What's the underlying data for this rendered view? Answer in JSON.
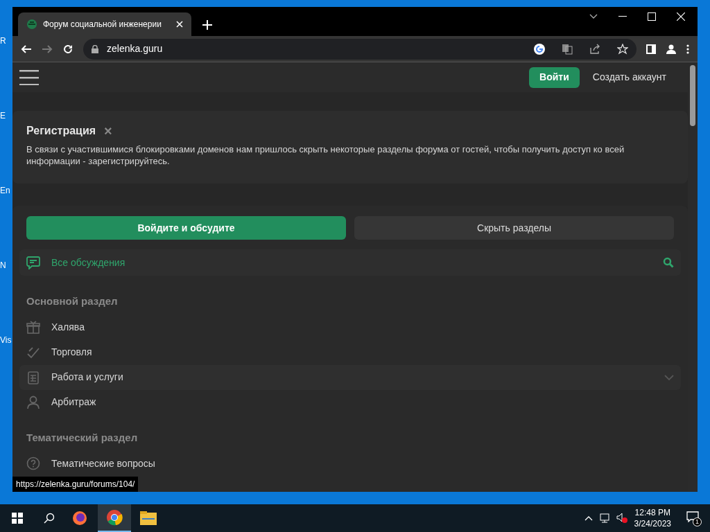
{
  "desktop": {
    "icon_labels": [
      "R",
      "E",
      "En",
      "N",
      "Vis"
    ]
  },
  "browser": {
    "tab": {
      "title": "Форум социальной инженерии",
      "selected": true
    },
    "url": "zelenka.guru",
    "status_url": "https://zelenka.guru/forums/104/"
  },
  "header": {
    "login": "Войти",
    "register": "Создать аккаунт"
  },
  "notice": {
    "title": "Регистрация",
    "close": "×",
    "text": "В связи с участившимися блокировками доменов нам пришлось скрыть некоторые разделы форума от гостей, чтобы получить доступ ко всей информации - зарегистрируйтесь."
  },
  "actions": [
    {
      "label": "Войдите и обсудите",
      "kind": "primary"
    },
    {
      "label": "Скрыть разделы",
      "kind": "secondary"
    }
  ],
  "all_discussions": "Все обсуждения",
  "sections": [
    {
      "title": "Основной раздел",
      "items": [
        {
          "label": "Халява",
          "kind": "gift",
          "highlighted": false
        },
        {
          "label": "Торговля",
          "kind": "trade",
          "highlighted": false
        },
        {
          "label": "Работа и услуги",
          "kind": "clipboard",
          "highlighted": true
        },
        {
          "label": "Арбитраж",
          "kind": "person",
          "highlighted": false
        }
      ]
    },
    {
      "title": "Тематический раздел",
      "items": [
        {
          "label": "Тематические вопросы",
          "kind": "question",
          "highlighted": false
        }
      ]
    }
  ],
  "taskbar": {
    "time": "12:48 PM",
    "date": "3/24/2023",
    "notifications": "1"
  }
}
